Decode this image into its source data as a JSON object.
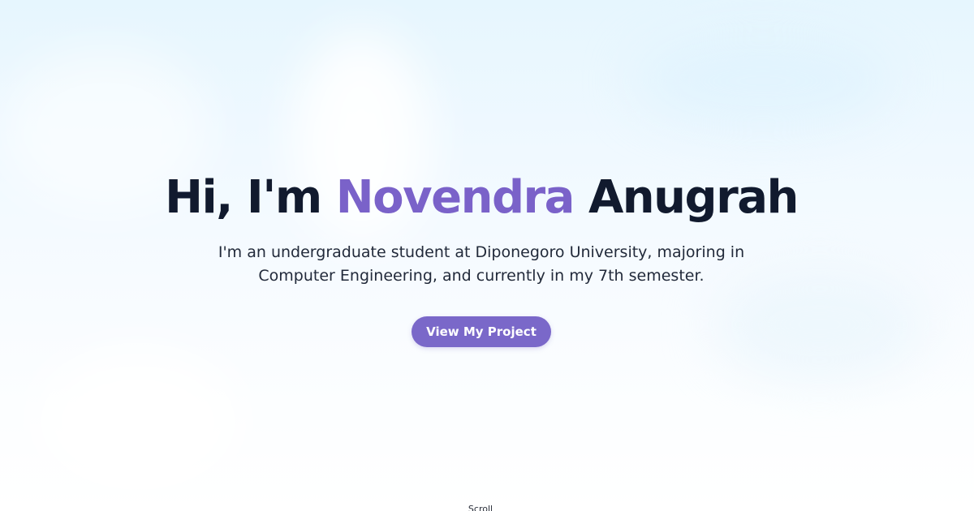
{
  "hero": {
    "greeting": "Hi, I'm",
    "first_name": "Novendra",
    "last_name": "Anugrah",
    "subtitle": "I'm an undergraduate student at Diponegoro University, majoring in Computer Engineering, and currently in my 7th semester.",
    "cta_label": "View My Project"
  },
  "scroll": {
    "label": "Scroll"
  },
  "colors": {
    "accent": "#7a62c9",
    "button": "#7a68c9",
    "heading": "#111a2e",
    "background_top": "#e6f6fe"
  }
}
